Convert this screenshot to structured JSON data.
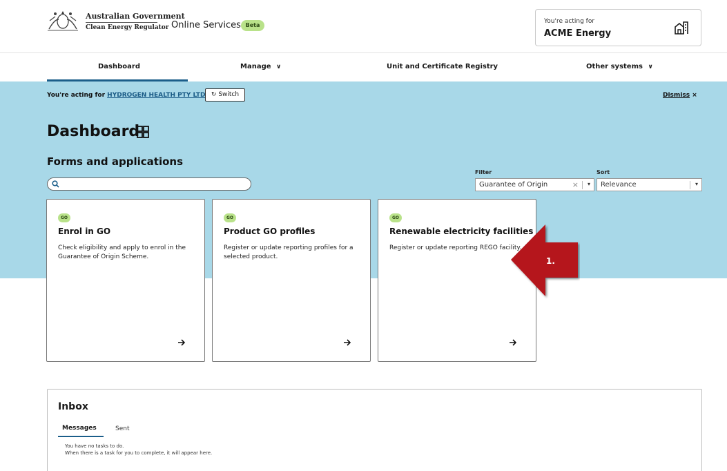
{
  "header": {
    "gov_name": "Australian Government",
    "agency_name": "Clean Energy Regulator",
    "app_name": "Online Services",
    "beta_label": "Beta",
    "acting_label": "You're acting for",
    "acting_org": "ACME Energy"
  },
  "nav": {
    "items": [
      {
        "label": "Dashboard",
        "active": true
      },
      {
        "label": "Manage",
        "dropdown": true
      },
      {
        "label": "Unit and Certificate Registry"
      },
      {
        "label": "Other systems",
        "dropdown": true
      }
    ]
  },
  "banner": {
    "prefix": "You're acting for",
    "org_link": "HYDROGEN HEALTH PTY LTD",
    "switch_label": "Switch",
    "dismiss_label": "Dismiss",
    "dismiss_icon": "×"
  },
  "page": {
    "title": "Dashboard",
    "section_title": "Forms and applications",
    "search_placeholder": ""
  },
  "filter": {
    "label": "Filter",
    "value": "Guarantee of Origin",
    "clear": "×"
  },
  "sort": {
    "label": "Sort",
    "value": "Relevance"
  },
  "cards": [
    {
      "badge": "GO",
      "title": "Enrol in GO",
      "description": "Check eligibility and apply to enrol in the Guarantee of Origin Scheme."
    },
    {
      "badge": "GO",
      "title": "Product GO profiles",
      "description": "Register or update reporting profiles for a selected product."
    },
    {
      "badge": "GO",
      "title": "Renewable electricity facilities",
      "description": "Register or update reporting REGO facility."
    }
  ],
  "annotation": {
    "label": "1.",
    "color": "#b5121b"
  },
  "inbox": {
    "title": "Inbox",
    "tabs": [
      {
        "label": "Messages",
        "active": true
      },
      {
        "label": "Sent"
      }
    ],
    "empty_line1": "You have no tasks to do.",
    "empty_line2": "When there is a task for you to complete, it will appear here."
  },
  "colors": {
    "band": "#a8d8e8",
    "accent": "#1b5e8a",
    "badge_green": "#b9e28a"
  }
}
